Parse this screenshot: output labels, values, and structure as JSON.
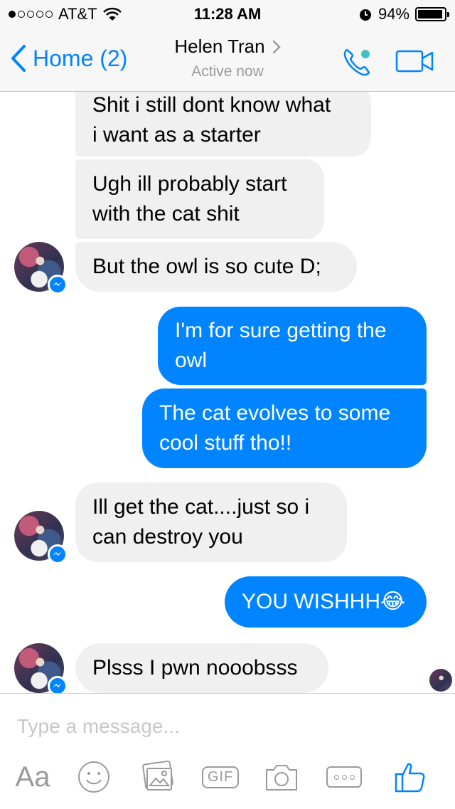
{
  "status_bar": {
    "carrier": "AT&T",
    "time": "11:28 AM",
    "battery_percent": "94%",
    "battery_level": 0.94,
    "signal_bars": 1
  },
  "nav": {
    "back_label": "Home (2)",
    "contact_name": "Helen Tran",
    "contact_status": "Active now"
  },
  "messages": [
    {
      "sender": "them",
      "text_lines": [
        "Shit i still dont know what",
        "i want as a starter"
      ]
    },
    {
      "sender": "them",
      "text_lines": [
        "Ugh ill probably start",
        "with the cat shit"
      ]
    },
    {
      "sender": "them",
      "text_lines": [
        "But the owl is so cute D;"
      ]
    },
    {
      "sender": "me",
      "text_lines": [
        "I'm for sure getting the",
        "owl"
      ]
    },
    {
      "sender": "me",
      "text_lines": [
        "The cat evolves to some",
        "cool stuff tho!!"
      ]
    },
    {
      "sender": "them",
      "text_lines": [
        "Ill get the cat....just so i",
        "can destroy you"
      ]
    },
    {
      "sender": "me",
      "text_lines": [
        "YOU WISHHH😂"
      ]
    },
    {
      "sender": "them",
      "text_lines": [
        "Plsss I pwn nooobsss"
      ]
    }
  ],
  "composer": {
    "placeholder": "Type a message...",
    "aa_label": "Aa",
    "gif_label": "GIF"
  },
  "colors": {
    "accent": "#0084ff",
    "incoming_bubble": "#f1f0f0",
    "active_dot": "#44bec7"
  },
  "icons": [
    "back-chevron-icon",
    "chevron-right-icon",
    "phone-icon",
    "video-camera-icon",
    "messenger-badge-icon",
    "emoji-icon",
    "photo-icon",
    "camera-icon",
    "more-icon",
    "thumbs-up-icon",
    "wifi-icon",
    "alarm-icon",
    "battery-icon"
  ]
}
